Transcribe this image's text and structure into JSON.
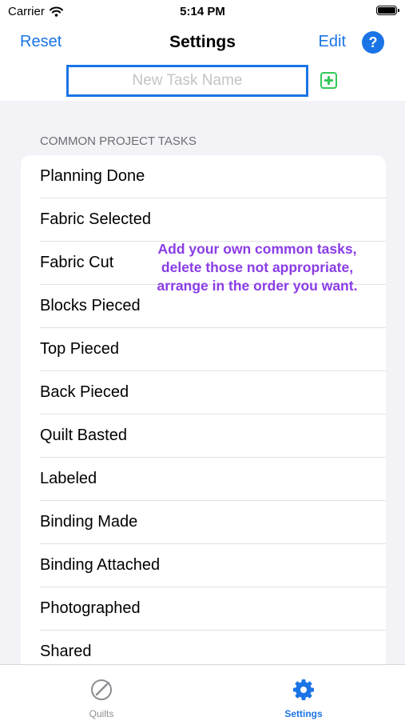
{
  "status_bar": {
    "carrier": "Carrier",
    "time": "5:14 PM"
  },
  "nav": {
    "left_label": "Reset",
    "title": "Settings",
    "right_label": "Edit",
    "help_label": "?"
  },
  "new_task": {
    "placeholder": "New Task Name",
    "value": ""
  },
  "section_header": "COMMON PROJECT TASKS",
  "tasks": [
    "Planning Done",
    "Fabric Selected",
    "Fabric Cut",
    "Blocks Pieced",
    "Top Pieced",
    "Back Pieced",
    "Quilt Basted",
    "Labeled",
    "Binding Made",
    "Binding Attached",
    "Photographed",
    "Shared"
  ],
  "hint": [
    "Add your own common tasks,",
    "delete those not appropriate,",
    "arrange in the order you want."
  ],
  "tabs": [
    {
      "label": "Quilts",
      "icon": "quilt-pencil-icon",
      "selected": false
    },
    {
      "label": "Settings",
      "icon": "gear-icon",
      "selected": true
    }
  ],
  "colors": {
    "accent": "#1a74e6",
    "add": "#34c759",
    "hint": "#8a3ce6",
    "background": "#f2f2f7"
  }
}
